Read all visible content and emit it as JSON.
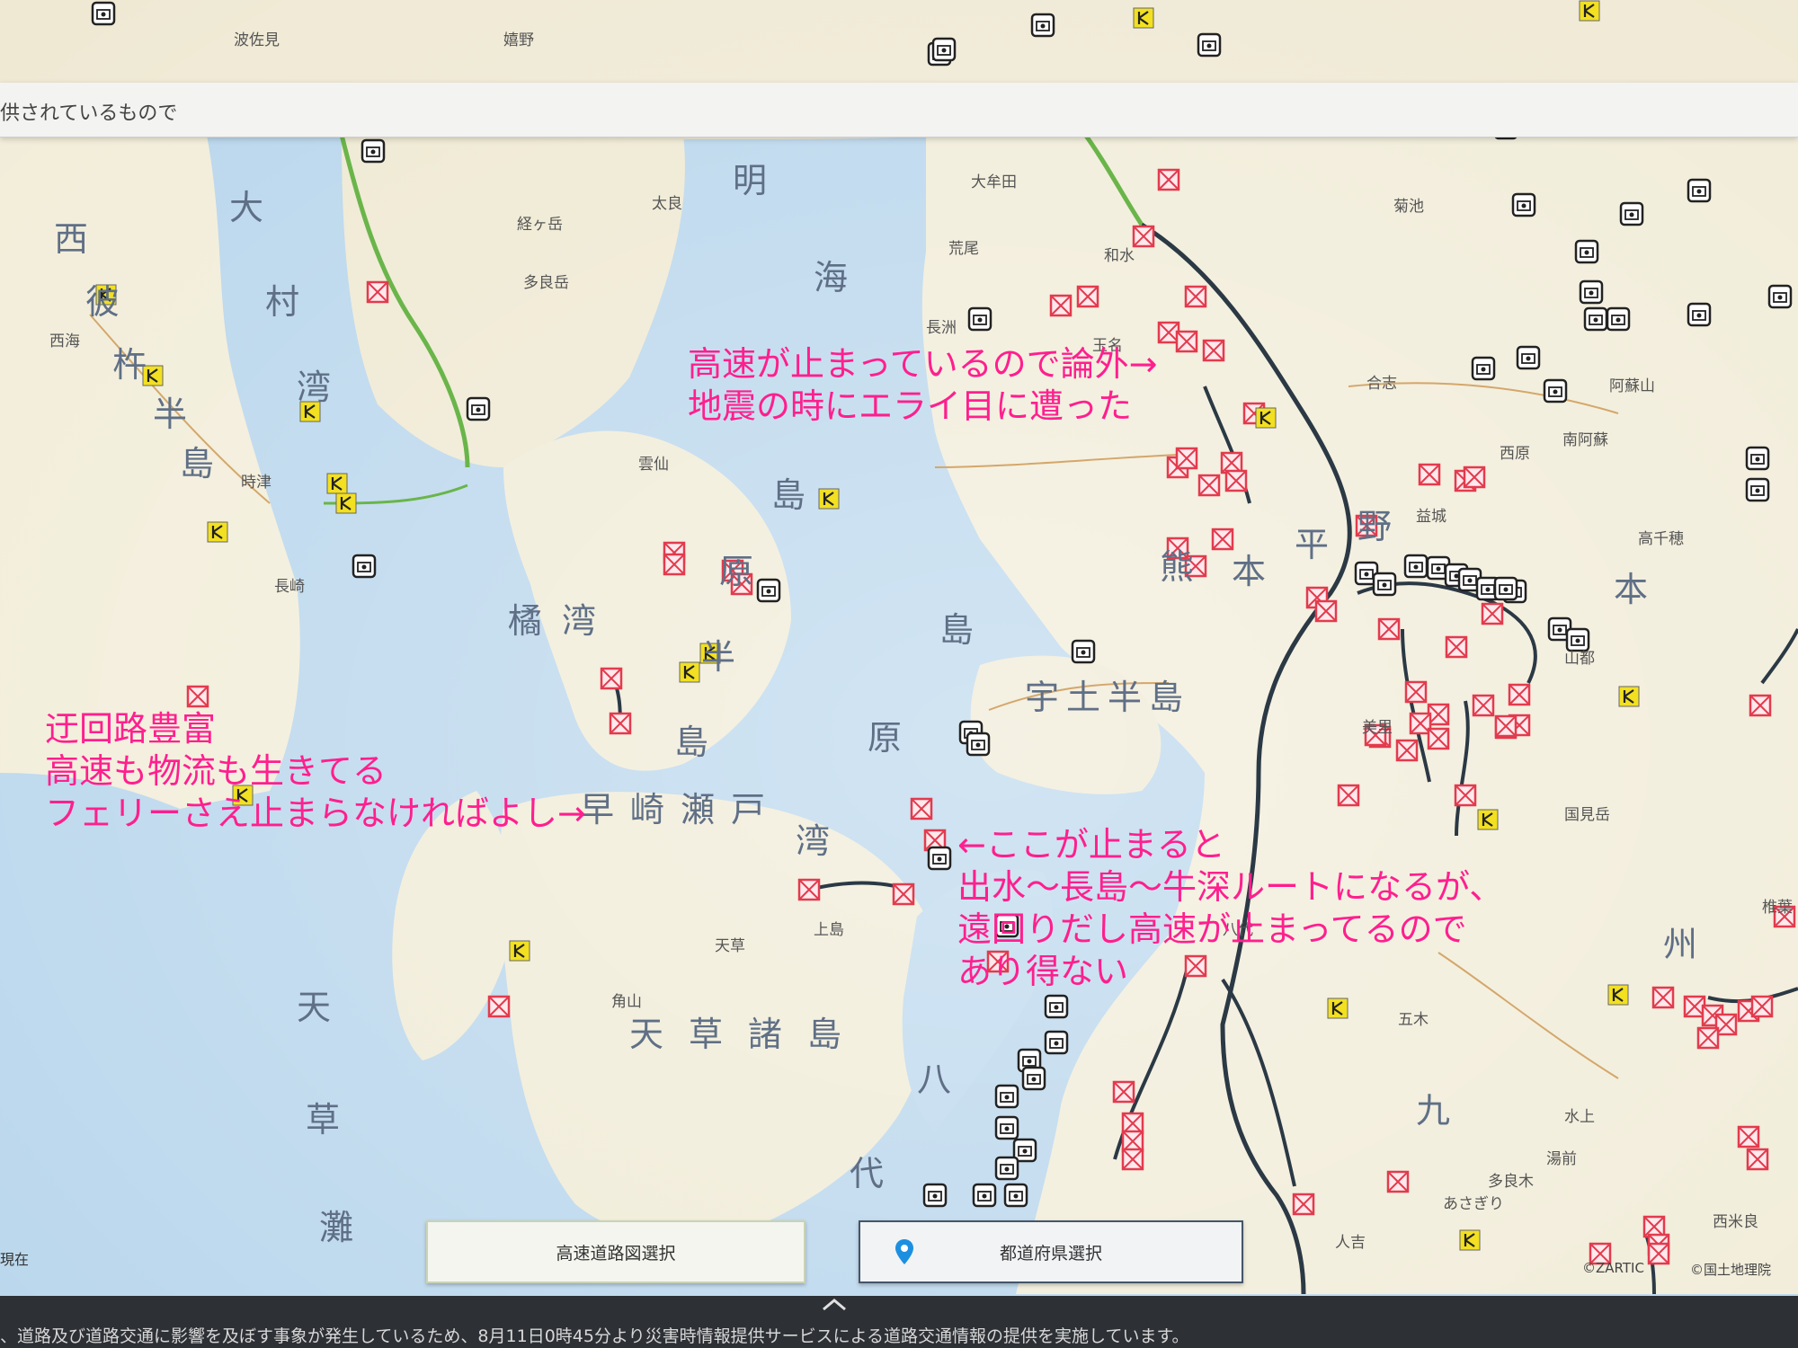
{
  "topbar": {
    "text": "供されているもので"
  },
  "map_labels": {
    "sea_ariake": [
      "明",
      "海"
    ],
    "omura_bay": [
      "大",
      "村",
      "湾"
    ],
    "nishisonogi": [
      "西",
      "彼",
      "杵",
      "半",
      "島"
    ],
    "shimabara_peninsula": [
      "島",
      "原",
      "半",
      "島"
    ],
    "tachibana_bay": [
      "橘",
      "湾"
    ],
    "shimabara_bay": [
      "島",
      "原",
      "湾"
    ],
    "hayasaki": "早崎瀬戸",
    "uto_peninsula": "宇土半島",
    "kumamoto_plain": [
      "熊",
      "本",
      "平",
      "野"
    ],
    "amakusa": "天草諸島",
    "amakusa_nada": [
      "天",
      "草",
      "灘"
    ],
    "yatsushiro": [
      "八",
      "代"
    ],
    "kyushu_mt": [
      "九",
      "州"
    ],
    "hon": "本"
  },
  "places": [
    "波佐見",
    "嬉野",
    "大牟田",
    "荒尾",
    "太良",
    "長崎",
    "時津",
    "雲仙",
    "西海",
    "多良岳",
    "経ヶ岳",
    "合志",
    "西原",
    "南阿蘇",
    "阿蘇山",
    "高千穂",
    "五木",
    "水上",
    "湯前",
    "多良木",
    "あさぎり",
    "人吉",
    "山都",
    "美里",
    "国見岳",
    "天草",
    "角山",
    "上島",
    "西米良",
    "椎葉",
    "八代",
    "玉名",
    "長洲",
    "和水",
    "菊池",
    "益城"
  ],
  "annotations": {
    "expressway": [
      "高速が止まっているので論外→",
      "地震の時にエライ目に遭った"
    ],
    "detour": [
      "迂回路豊富",
      "高速も物流も生きてる",
      "フェリーさえ止まらなければよし→"
    ],
    "route": [
      "←ここが止まると",
      "出水～長島～牛深ルートになるが、",
      "遠回りだし高速が止まってるので",
      "あり得ない"
    ]
  },
  "buttons": {
    "expressway_map": "高速道路図選択",
    "prefecture": "都道府県選択"
  },
  "left_status": "現在",
  "credits": [
    "©ZARTIC",
    "©国土地理院"
  ],
  "bottom_notice": "、道路及び道路交通に影響を及ぼす事象が発生しているため、8月11日0時45分より災害時情報提供サービスによる道路交通情報の提供を実施しています。",
  "colors": {
    "annotation": "#ff1f8e",
    "closure": "#e23b4e",
    "camera": "#222222",
    "parking": "#f2e021",
    "sea": "#b9d6ec",
    "land": "#f1ecd8"
  }
}
